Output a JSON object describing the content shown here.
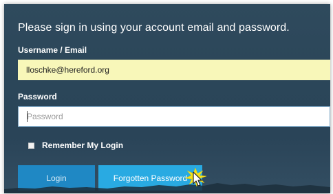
{
  "form": {
    "heading": "Please sign in using your account email and password.",
    "username_label": "Username / Email",
    "username_value": "lloschke@hereford.org",
    "password_label": "Password",
    "password_placeholder": "Password",
    "remember_label": "Remember My Login",
    "remember_checked": false,
    "login_button": "Login",
    "forgot_button": "Forgotten Password"
  },
  "colors": {
    "panel_background": "#2b4659",
    "email_field_background": "#f8f7b9",
    "login_button": "#1f88c4",
    "forgot_button": "#29aae2",
    "click_highlight": "#f5e21b"
  },
  "icons": {
    "cursor": "pointer-hand-icon",
    "click_burst": "click-burst-icon"
  }
}
